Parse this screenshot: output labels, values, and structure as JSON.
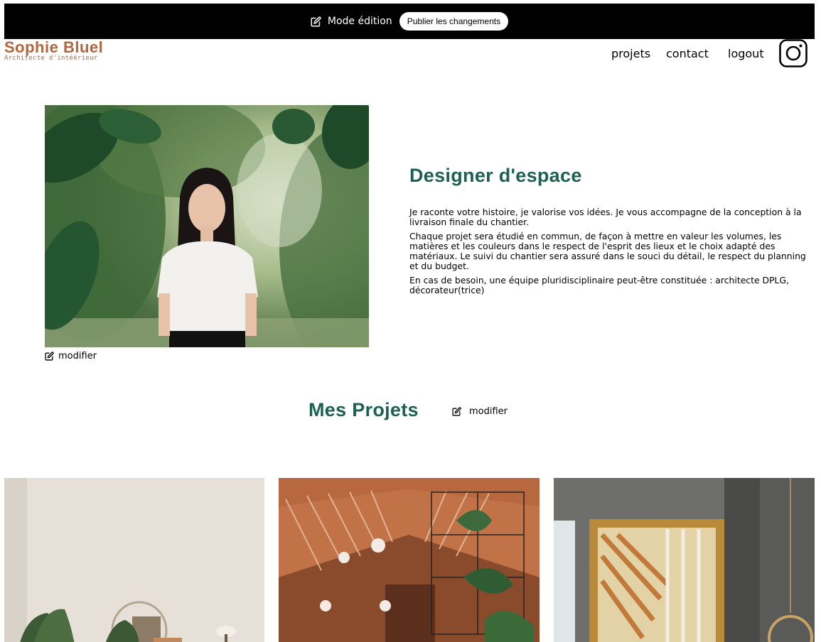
{
  "edit_bar": {
    "mode_label": "Mode édition",
    "publish_label": "Publier les changements"
  },
  "logo": {
    "name": "Sophie Bluel",
    "subtitle": "Architecte d'intéérieur",
    "color": "#B1663C"
  },
  "nav": {
    "items": [
      "projets",
      "contact",
      "logout"
    ],
    "instagram_icon": "instagram-icon"
  },
  "intro": {
    "title": "Designer d'espace",
    "paragraphs": [
      "Je raconte votre histoire, je valorise vos idées. Je vous accompagne de la conception à la livraison finale du chantier.",
      "Chaque projet sera étudié en commun, de façon à mettre en valeur les volumes, les matières et les couleurs dans le respect de l'esprit des lieux et le choix adapté des matériaux. Le suivi du chantier sera assuré dans le souci du détail, le respect du planning et du budget.",
      "En cas de besoin, une équipe pluridisciplinaire peut-être constituée : architecte DPLG, décorateur(trice)"
    ],
    "modify_label": "modifier"
  },
  "projects": {
    "title": "Mes Projets",
    "modify_label": "modifier"
  },
  "colors": {
    "accent": "#1D6154",
    "brand": "#B1663C",
    "edit_bar": "#000000"
  }
}
